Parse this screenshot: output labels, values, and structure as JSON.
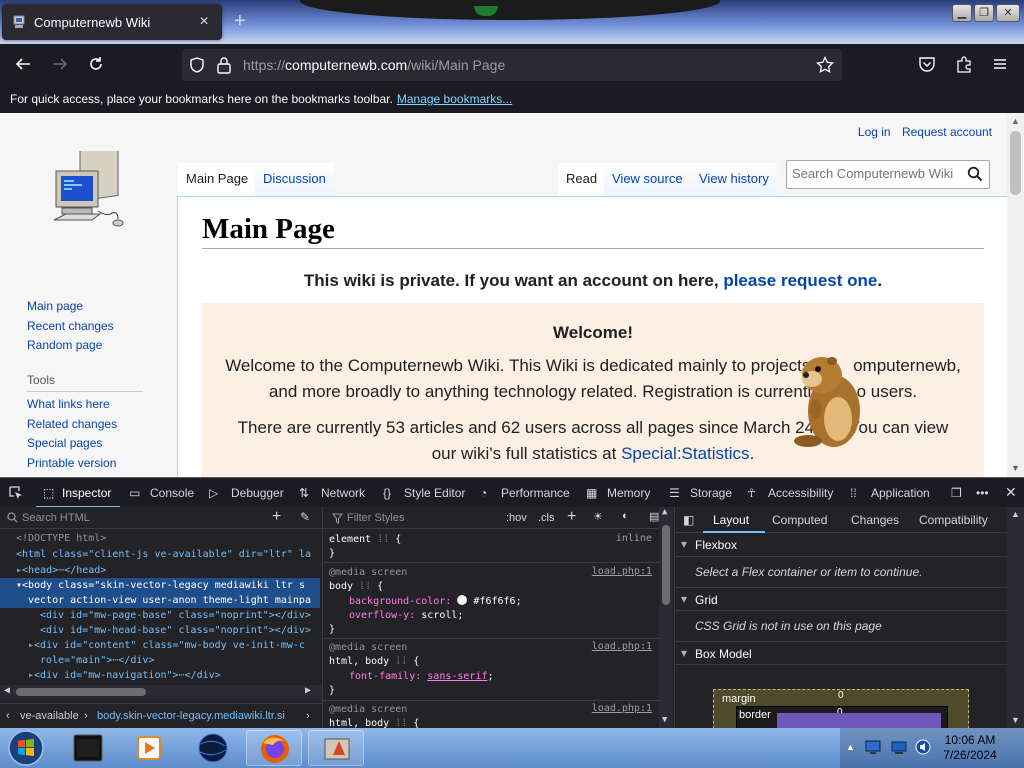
{
  "browser": {
    "tab_title": "Computernewb Wiki",
    "url_prefix": "https://",
    "url_host": "computernewb.com",
    "url_path": "/wiki/Main Page",
    "bookmarks_text": "For quick access, place your bookmarks here on the bookmarks toolbar.",
    "bookmarks_link": "Manage bookmarks..."
  },
  "wiki": {
    "personal": [
      "Log in",
      "Request account"
    ],
    "tabs": {
      "main": "Main Page",
      "discussion": "Discussion",
      "read": "Read",
      "view_source": "View source",
      "view_history": "View history"
    },
    "search_placeholder": "Search Computernewb Wiki",
    "heading": "Main Page",
    "private_text": "This wiki is private. If you want an account on here, ",
    "private_link": "please request one",
    "private_end": ".",
    "welcome_title": "Welcome!",
    "welcome_p1a": "Welcome to the Computernewb Wiki. This Wiki is dedicated mainly to projects",
    "welcome_p1b": "omputernewb,",
    "welcome_p2a": "and more broadly to anything technology related. Registration is currently",
    "welcome_p2b": "o users.",
    "welcome_p3a": "There are currently 53 articles and 62 users across all pages since March 24",
    "welcome_p3b": "You can view",
    "welcome_p4": "our wiki's full statistics at ",
    "welcome_p4_link": "Special:Statistics",
    "welcome_p4_end": ".",
    "nav": [
      "Main page",
      "Recent changes",
      "Random page"
    ],
    "tools_heading": "Tools",
    "tools": [
      "What links here",
      "Related changes",
      "Special pages",
      "Printable version"
    ]
  },
  "devtools": {
    "tabs": [
      "Inspector",
      "Console",
      "Debugger",
      "Network",
      "Style Editor",
      "Performance",
      "Memory",
      "Storage",
      "Accessibility",
      "Application"
    ],
    "search_html": "Search HTML",
    "filter_styles": "Filter Styles",
    "hov": ":hov",
    "cls": ".cls",
    "markup": [
      "<!DOCTYPE html>",
      "<html class=\"client-js ve-available\" dir=\"ltr\" la",
      "<head>",
      "</head>",
      "<body class=\"skin-vector-legacy mediawiki ltr s",
      "vector action-view user-anon theme-light mainpa",
      "<div id=\"mw-page-base\" class=\"noprint\"></div>",
      "<div id=\"mw-head-base\" class=\"noprint\"></div>",
      "<div id=\"content\" class=\"mw-body ve-init-mw-c",
      "role=\"main\">",
      "</div>",
      "<div id=\"mw-navigation\">",
      "</div>"
    ],
    "breadcrumb_1": "ve-available",
    "breadcrumb_2": "body.skin-vector-legacy.mediawiki.ltr.si",
    "rules": {
      "element": "element",
      "inline": "inline",
      "media": "@media screen",
      "body_sel": "body",
      "bg_prop": "background-color:",
      "bg_val": "#f6f6f6;",
      "ov_prop": "overflow-y:",
      "ov_val": "scroll;",
      "src": "load.php:1",
      "htmlbody_sel": "html, body",
      "ff_prop": "font-family:",
      "ff_val": "sans-serif",
      "brace_open": "{",
      "brace_close": "}"
    },
    "layout_tabs": [
      "Layout",
      "Computed",
      "Changes",
      "Compatibility"
    ],
    "flexbox": "Flexbox",
    "flexbox_note": "Select a Flex container or item to continue.",
    "grid": "Grid",
    "grid_note": "CSS Grid is not in use on this page",
    "box_model": "Box Model",
    "bm_margin": "margin",
    "bm_border": "border",
    "bm_zero": "0"
  },
  "taskbar": {
    "time": "10:06 AM",
    "date": "7/26/2024"
  },
  "colors": {
    "link": "#0645ad",
    "devtools_accent": "#75bfff",
    "welcome_bg": "#fcefe3"
  }
}
